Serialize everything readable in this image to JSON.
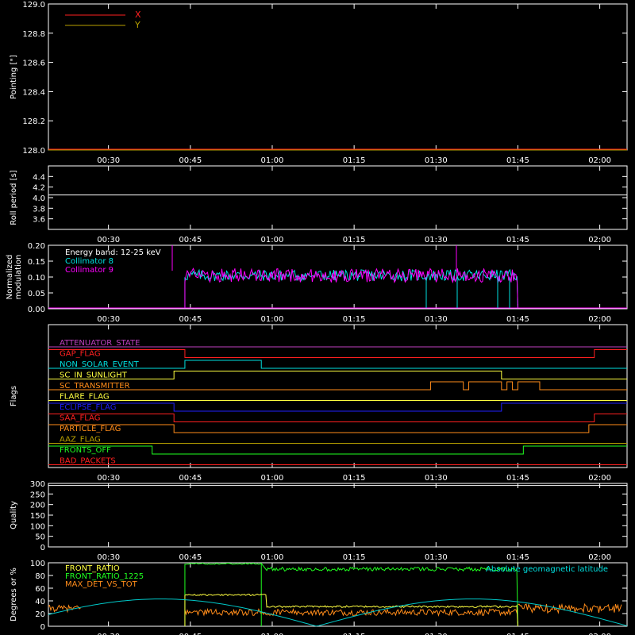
{
  "time_ticks": [
    "00:30",
    "00:45",
    "01:00",
    "01:15",
    "01:30",
    "01:45",
    "02:00"
  ],
  "colors": {
    "background": "#000000",
    "axes": "#ffffff",
    "red": "#ff2020",
    "olive": "#b8a000",
    "cyan": "#00e0e0",
    "magenta": "#ff00ff",
    "yellow": "#ffff40",
    "orange": "#ff8c1a",
    "green": "#20ff20",
    "blue": "#2020ff",
    "purple": "#c040c0",
    "teal": "#00c8c8"
  },
  "chart_data": [
    {
      "type": "line",
      "ylabel": "Pointing [\"]",
      "ylim": [
        128.0,
        129.0
      ],
      "yticks": [
        "128.0",
        "128.2",
        "128.4",
        "128.6",
        "128.8",
        "129.0"
      ],
      "legend": [
        "X",
        "Y"
      ],
      "legend_placement": "top-left",
      "series": [
        {
          "name": "X",
          "color": "red",
          "x": [
            "00:19",
            "02:05"
          ],
          "y": [
            128.0,
            128.0
          ]
        },
        {
          "name": "Y",
          "color": "olive",
          "x": [
            "00:19",
            "02:05"
          ],
          "y": [
            128.0,
            128.0
          ]
        }
      ]
    },
    {
      "type": "line",
      "ylabel": "Roll period [s]",
      "ylim": [
        3.4,
        4.6
      ],
      "yticks": [
        "3.6",
        "3.8",
        "4.0",
        "4.2",
        "4.4"
      ],
      "series": [
        {
          "color": "axes",
          "x": [
            "00:19",
            "02:05"
          ],
          "y": [
            4.05,
            4.05
          ]
        }
      ]
    },
    {
      "type": "line",
      "ylabel": [
        "Normalized",
        "modulation"
      ],
      "ylim": [
        0.0,
        0.2
      ],
      "yticks": [
        "0.00",
        "0.05",
        "0.10",
        "0.15",
        "0.20"
      ],
      "legend": [
        "Energy band: 12-25 keV",
        "Collimator 8",
        "Collimator 9"
      ],
      "legend_placement": "top-left",
      "series": [
        {
          "name": "Collimator 8",
          "color": "cyan",
          "x": [
            "00:44",
            "01:45"
          ],
          "y_mean": 0.105,
          "y_spread": 0.018
        },
        {
          "name": "Collimator 9",
          "color": "magenta",
          "x": [
            "00:44",
            "01:45"
          ],
          "y_mean": 0.105,
          "y_spread": 0.022
        }
      ]
    },
    {
      "type": "line",
      "ylabel": "Flags",
      "flags": [
        {
          "label": "ATTENUATOR_STATE",
          "color": "purple",
          "segments": [
            [
              "00:19",
              "02:05",
              0
            ]
          ]
        },
        {
          "label": "GAP_FLAG",
          "color": "red",
          "segments": [
            [
              "00:19",
              "00:44",
              1
            ],
            [
              "00:44",
              "01:59",
              0
            ],
            [
              "01:59",
              "02:05",
              1
            ]
          ]
        },
        {
          "label": "NON_SOLAR_EVENT",
          "color": "cyan",
          "segments": [
            [
              "00:19",
              "00:44",
              0
            ],
            [
              "00:44",
              "00:58",
              1
            ],
            [
              "00:58",
              "02:05",
              0
            ]
          ]
        },
        {
          "label": "SC_IN_SUNLIGHT",
          "color": "yellow",
          "segments": [
            [
              "00:19",
              "00:42",
              0
            ],
            [
              "00:42",
              "01:42",
              1
            ],
            [
              "01:42",
              "02:05",
              0
            ]
          ]
        },
        {
          "label": "SC_TRANSMITTER",
          "color": "orange",
          "segments": [
            [
              "00:19",
              "01:29",
              0
            ],
            [
              "01:29",
              "01:35",
              1
            ],
            [
              "01:35",
              "01:36",
              0
            ],
            [
              "01:36",
              "01:42",
              1
            ],
            [
              "01:42",
              "01:43",
              0
            ],
            [
              "01:43",
              "01:44",
              1
            ],
            [
              "01:44",
              "01:45",
              0
            ],
            [
              "01:45",
              "01:49",
              1
            ],
            [
              "01:49",
              "02:05",
              0
            ]
          ]
        },
        {
          "label": "FLARE_FLAG",
          "color": "yellow",
          "segments": [
            [
              "00:19",
              "02:05",
              0
            ]
          ]
        },
        {
          "label": "ECLIPSE_FLAG",
          "color": "blue",
          "segments": [
            [
              "00:19",
              "00:42",
              1
            ],
            [
              "00:42",
              "01:42",
              0
            ],
            [
              "01:42",
              "02:05",
              1
            ]
          ]
        },
        {
          "label": "SAA_FLAG",
          "color": "red",
          "segments": [
            [
              "00:19",
              "00:42",
              1
            ],
            [
              "00:42",
              "01:59",
              0
            ],
            [
              "01:59",
              "02:05",
              1
            ]
          ]
        },
        {
          "label": "PARTICLE_FLAG",
          "color": "orange",
          "segments": [
            [
              "00:19",
              "00:42",
              1
            ],
            [
              "00:42",
              "01:58",
              0
            ],
            [
              "01:58",
              "02:05",
              1
            ]
          ]
        },
        {
          "label": "AAZ_FLAG",
          "color": "olive",
          "segments": [
            [
              "00:19",
              "02:05",
              0
            ]
          ]
        },
        {
          "label": "FRONTS_OFF",
          "color": "green",
          "segments": [
            [
              "00:19",
              "00:38",
              1
            ],
            [
              "00:38",
              "01:46",
              0
            ],
            [
              "01:46",
              "02:05",
              1
            ]
          ]
        },
        {
          "label": "BAD_PACKETS",
          "color": "red",
          "segments": [
            [
              "00:19",
              "02:05",
              0
            ]
          ]
        }
      ]
    },
    {
      "type": "line",
      "ylabel": "Quality",
      "ylim": [
        0,
        300
      ],
      "yticks": [
        "0",
        "50",
        "100",
        "150",
        "200",
        "250",
        "300"
      ],
      "series": [
        {
          "color": "axes",
          "x": [
            "00:19",
            "02:05"
          ],
          "y": [
            290,
            290
          ]
        }
      ]
    },
    {
      "type": "line",
      "ylabel": "Degrees or %",
      "ylim": [
        0,
        100
      ],
      "yticks": [
        "0",
        "20",
        "40",
        "60",
        "80",
        "100"
      ],
      "legend": [
        "FRONT_RATIO",
        "FRONT_RATIO_1225",
        "MAX_DET_VS_TOT"
      ],
      "legend_placement": "top-left",
      "annotation": "Absolute geomagnetic latitude",
      "series": [
        {
          "name": "FRONT_RATIO",
          "color": "yellow",
          "x": [
            "00:44",
            "00:59",
            "00:59",
            "01:45"
          ],
          "y": [
            50,
            49,
            35,
            30
          ]
        },
        {
          "name": "FRONT_RATIO_1225",
          "color": "green",
          "x": [
            "00:44",
            "00:58",
            "00:59",
            "01:45"
          ],
          "y": [
            99,
            98,
            91,
            90
          ]
        },
        {
          "name": "MAX_DET_VS_TOT",
          "color": "orange",
          "x": [
            "00:19",
            "02:05"
          ],
          "y_mean": 22,
          "y_spread": 5
        },
        {
          "name": "Absolute geomagnetic latitude",
          "color": "teal",
          "x": [
            "00:19",
            "00:56",
            "01:11",
            "01:36",
            "02:05"
          ],
          "y": [
            5,
            43,
            0,
            43,
            0
          ]
        }
      ]
    }
  ]
}
